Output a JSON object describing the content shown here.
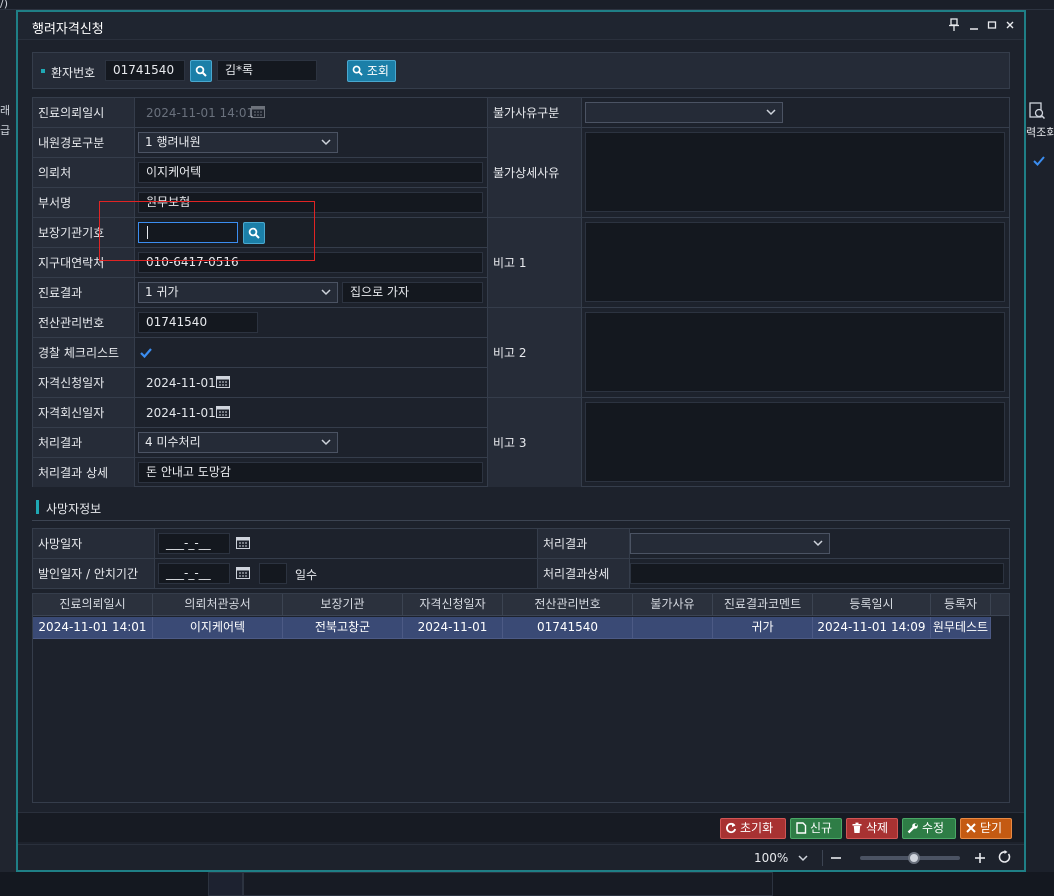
{
  "window": {
    "title": "행려자격신청"
  },
  "background": {
    "left_labels": [
      "래",
      "급"
    ],
    "right_label": "력조회",
    "top_fragment": "/)"
  },
  "search": {
    "patient_no_label": "환자번호",
    "patient_no": "01741540",
    "patient_name": "김*록",
    "query_label": "조회"
  },
  "form": {
    "request_datetime_label": "진료의뢰일시",
    "request_datetime": "2024-11-01 14:01",
    "route_label": "내원경로구분",
    "route": "1 행려내원",
    "referrer_label": "의뢰처",
    "referrer": "이지케어텍",
    "dept_label": "부서명",
    "dept": "원무보험",
    "insurer_code_label": "보장기관기호",
    "insurer_code": "",
    "district_contact_label": "지구대연락처",
    "district_contact": "010-6417-0516",
    "result_label": "진료결과",
    "result": "1 귀가",
    "result_comment": "집으로 가자",
    "mgmt_no_label": "전산관리번호",
    "mgmt_no": "01741540",
    "police_check_label": "경찰 체크리스트",
    "apply_date_label": "자격신청일자",
    "apply_date": "2024-11-01",
    "reply_date_label": "자격회신일자",
    "reply_date": "2024-11-01",
    "process_result_label": "처리결과",
    "process_result": "4 미수처리",
    "process_detail_label": "처리결과 상세",
    "process_detail": "돈 안내고 도망감",
    "reject_type_label": "불가사유구분",
    "reject_type": "",
    "reject_detail_label": "불가상세사유",
    "note1_label": "비고 1",
    "note2_label": "비고 2",
    "note3_label": "비고 3"
  },
  "death": {
    "section_title": "사망자정보",
    "death_date_label": "사망일자",
    "death_date": "___-_-__",
    "found_label": "발인일자 / 안치기간",
    "found_date": "___-_-__",
    "days_unit": "일수",
    "result_label": "처리결과",
    "result_detail_label": "처리결과상세"
  },
  "table": {
    "columns": [
      "진료의뢰일시",
      "의뢰처관공서",
      "보장기관",
      "자격신청일자",
      "전산관리번호",
      "불가사유",
      "진료결과코멘트",
      "등록일시",
      "등록자"
    ],
    "rows": [
      [
        "2024-11-01 14:01",
        "이지케어텍",
        "전북고창군",
        "2024-11-01",
        "01741540",
        "",
        "귀가",
        "2024-11-01 14:09",
        "원무테스트"
      ]
    ]
  },
  "footer": {
    "reset_label": "초기화",
    "new_label": "신규",
    "delete_label": "삭제",
    "edit_label": "수정",
    "close_label": "닫기"
  },
  "status": {
    "zoom": "100%",
    "zoom_level": 0.55
  },
  "colors": {
    "accent": "#1fa8b4",
    "primary_button": "#1b7fa8",
    "reset": "#a83232",
    "new": "#2e7d46",
    "delete": "#a83232",
    "edit": "#2e7d46",
    "close": "#c45a12",
    "highlight_box": "#e02424"
  }
}
